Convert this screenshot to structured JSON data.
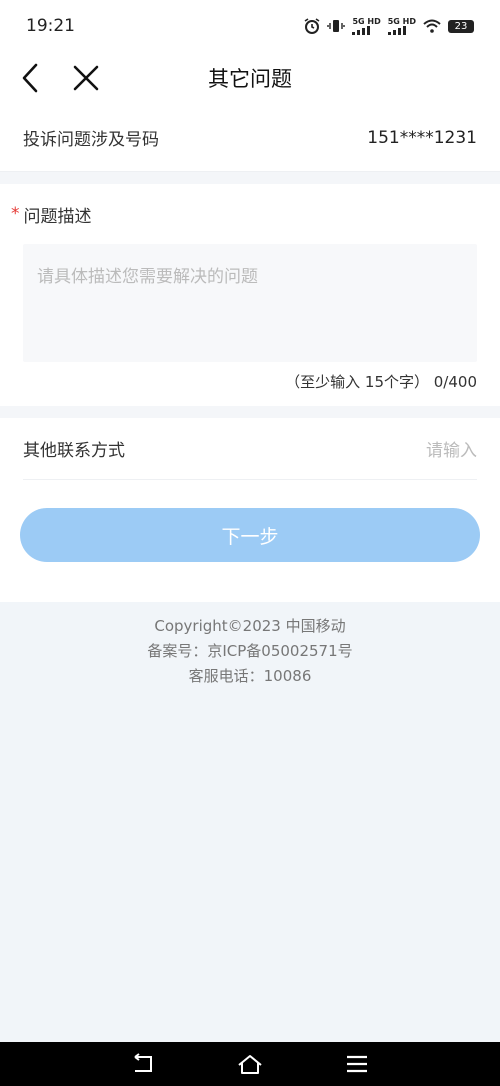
{
  "status_bar": {
    "time": "19:21",
    "signal1": "5G HD",
    "signal2": "5G HD",
    "battery": "23"
  },
  "nav": {
    "title": "其它问题"
  },
  "complaint": {
    "label": "投诉问题涉及号码",
    "number": "151****1231"
  },
  "description": {
    "required_mark": "*",
    "label": "问题描述",
    "placeholder": "请具体描述您需要解决的问题",
    "counter": "（至少输入 15个字） 0/400"
  },
  "contact": {
    "label": "其他联系方式",
    "placeholder": "请输入"
  },
  "next_button": {
    "label": "下一步"
  },
  "footer": {
    "copyright": "Copyright©2023 中国移动",
    "icp": "备案号：京ICP备05002571号",
    "service": "客服电话：10086"
  },
  "colors": {
    "button": "#9ccbf5",
    "required": "#e53935",
    "background": "#f1f5f9"
  }
}
